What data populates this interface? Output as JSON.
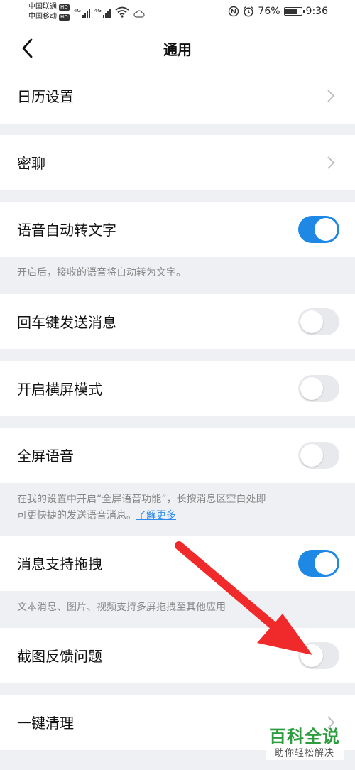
{
  "status_bar": {
    "carrier1": "中国联通",
    "carrier2": "中国移动",
    "hd_badge": "HD",
    "network1": "4G",
    "network2": "4G",
    "battery_percent": "76%",
    "battery_level": 0.76,
    "time": "9:36",
    "icons": [
      "wifi-icon",
      "cloud-icon",
      "nfc-icon",
      "alarm-icon",
      "battery-icon"
    ]
  },
  "header": {
    "title": "通用",
    "back_icon": "chevron-left-icon"
  },
  "settings": {
    "calendar": {
      "label": "日历设置"
    },
    "secret_chat": {
      "label": "密聊"
    },
    "voice_to_text": {
      "label": "语音自动转文字",
      "on": true,
      "note": "开启后，接收的语音将自动转为文字。"
    },
    "enter_send": {
      "label": "回车键发送消息",
      "on": false
    },
    "landscape": {
      "label": "开启横屏模式",
      "on": false
    },
    "fullscreen_voice": {
      "label": "全屏语音",
      "on": false,
      "note_line1": "在我的设置中开启“全屏语音功能”，长按消息区空白处即",
      "note_line2": "可更快捷的发送语音消息。",
      "link": "了解更多"
    },
    "drag_messages": {
      "label": "消息支持拖拽",
      "on": true,
      "note": "文本消息、图片、视频支持多屏拖拽至其他应用"
    },
    "screenshot_feedback": {
      "label": "截图反馈问题",
      "on": false
    },
    "one_click_clean": {
      "label": "一键清理"
    }
  },
  "watermark": {
    "title": "百科全说",
    "subtitle": "助你轻松解决"
  },
  "colors": {
    "toggle_on": "#1e88e5",
    "toggle_off": "#e8e9ec",
    "link": "#2d8cf0",
    "arrow": "#f02a2a",
    "background": "#eef0f3"
  }
}
